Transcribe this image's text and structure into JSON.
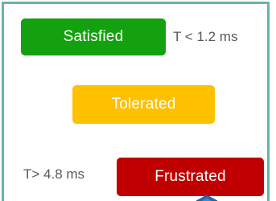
{
  "categories": {
    "satisfied": {
      "label": "Satisfied",
      "threshold": "T < 1.2 ms",
      "color": "#14a10f"
    },
    "tolerated": {
      "label": "Tolerated",
      "color": "#ffc000"
    },
    "frustrated": {
      "label": "Frustrated",
      "threshold": "T>  4.8 ms",
      "color": "#c00000"
    }
  },
  "frame_color": "#6ab4a4",
  "text_color": "#595959"
}
